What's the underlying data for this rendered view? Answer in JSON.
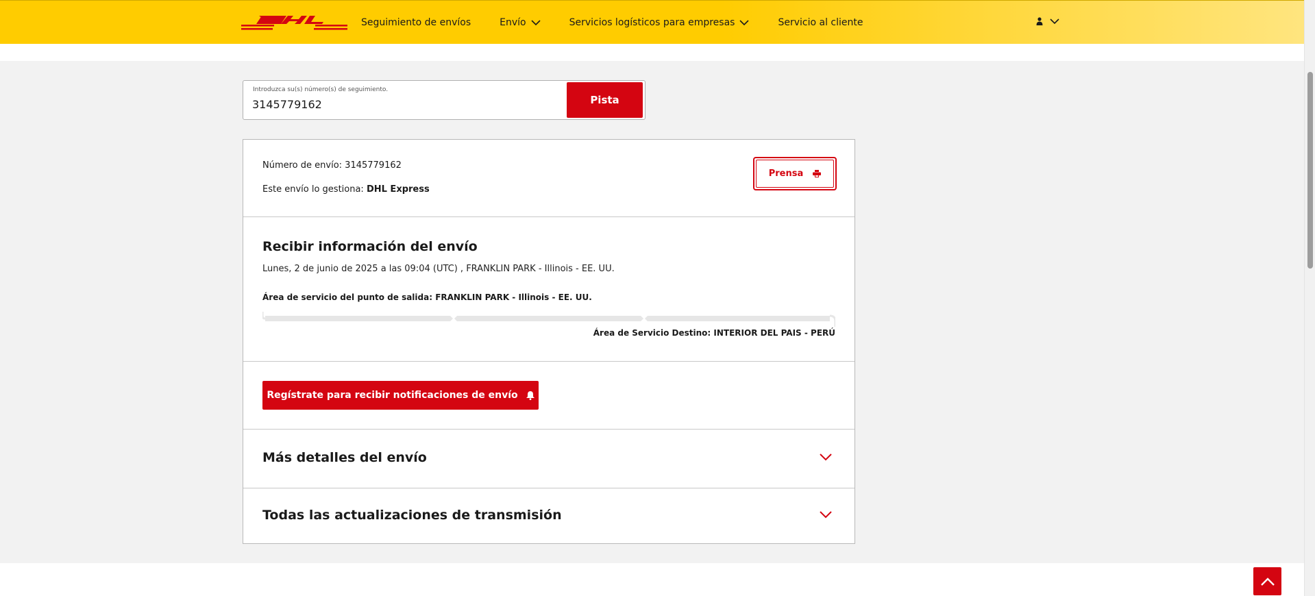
{
  "header": {
    "logo_text": "DHL",
    "nav": [
      {
        "label": "Seguimiento de envíos"
      },
      {
        "label": "Envío"
      },
      {
        "label": "Servicios logísticos para empresas"
      },
      {
        "label": "Servicio al cliente"
      }
    ]
  },
  "tracking": {
    "label": "Introduzca su(s) número(s) de seguimiento.",
    "value": "3145779162",
    "button": "Pista"
  },
  "shipment": {
    "number_label": "Número de envío: ",
    "number": "3145779162",
    "handled_label": "Este envío lo gestiona: ",
    "handler": "DHL Express",
    "print_button": "Prensa"
  },
  "info": {
    "title": "Recibir información del envío",
    "date": "Lunes, 2 de junio de 2025 a las 09:04 (UTC) , FRANKLIN PARK - Illinois - EE. UU.",
    "origin": "Área de servicio del punto de salida: FRANKLIN PARK - Illinois - EE. UU.",
    "destination": "Área de Servicio Destino: INTERIOR DEL PAIS - PERÚ",
    "progress_steps": 3
  },
  "notify": {
    "button": "Regístrate para recibir notificaciones de envío"
  },
  "accordions": [
    {
      "title": "Más detalles del envío"
    },
    {
      "title": "Todas las actualizaciones de transmisión"
    }
  ],
  "colors": {
    "brand_yellow": "#ffcc00",
    "brand_red": "#d40511"
  }
}
